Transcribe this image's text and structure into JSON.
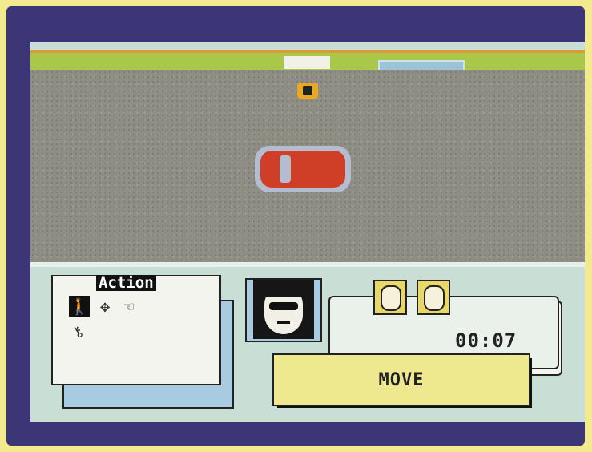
{
  "panel": {
    "action_title": "Action",
    "timer": "00:07",
    "move_label": "MOVE"
  },
  "icons": [
    "walk-icon",
    "crosshair-icon",
    "hand-icon",
    "key-icon",
    "agent-portrait",
    "suspect-face-icon"
  ],
  "colors": {
    "border": "#3c3676",
    "road": "#8f8e84",
    "grass": "#a9c84a",
    "car": "#cf3f28",
    "panel": "#c9dfd6",
    "move_button": "#eee98e"
  }
}
